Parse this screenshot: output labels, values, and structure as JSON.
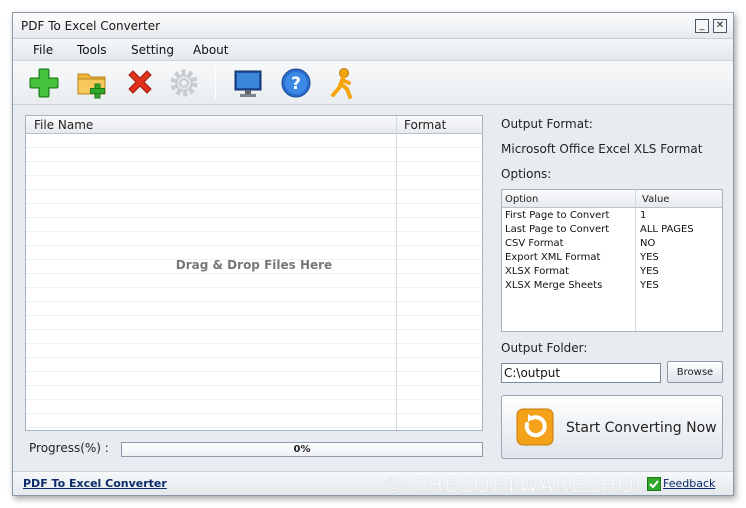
{
  "window": {
    "title": "PDF To Excel Converter"
  },
  "menu": [
    "File",
    "Tools",
    "Setting",
    "About"
  ],
  "toolbar": {
    "icons": [
      "add-file-icon",
      "add-folder-icon",
      "remove-icon",
      "settings-gear-icon",
      "monitor-icon",
      "help-icon",
      "run-person-icon"
    ]
  },
  "file_list": {
    "columns": [
      "File Name",
      "Format"
    ],
    "drop_hint": "Drag & Drop Files Here"
  },
  "progress": {
    "label": "Progress(%)  :",
    "text": "0%",
    "value": 0
  },
  "output": {
    "format_label": "Output Format:",
    "format_value": "Microsoft Office Excel XLS Format",
    "options_label": "Options:",
    "options_columns": [
      "Option",
      "Value"
    ],
    "options": [
      {
        "name": "First Page to Convert",
        "value": "1"
      },
      {
        "name": "Last Page to Convert",
        "value": "ALL PAGES"
      },
      {
        "name": "CSV Format",
        "value": "NO"
      },
      {
        "name": "Export XML Format",
        "value": "YES"
      },
      {
        "name": "XLSX Format",
        "value": "YES"
      },
      {
        "name": "XLSX Merge Sheets",
        "value": "YES"
      }
    ],
    "folder_label": "Output Folder:",
    "folder_value": "C:\\output",
    "browse_label": "Browse",
    "start_label": "Start Converting Now"
  },
  "status": {
    "app_link": "PDF To Excel Converter",
    "watermark": "© THESOFTWARESHOP",
    "feedback": "Feedback"
  },
  "colors": {
    "accent": "#4aa0e0",
    "link": "#0b2a6a"
  }
}
